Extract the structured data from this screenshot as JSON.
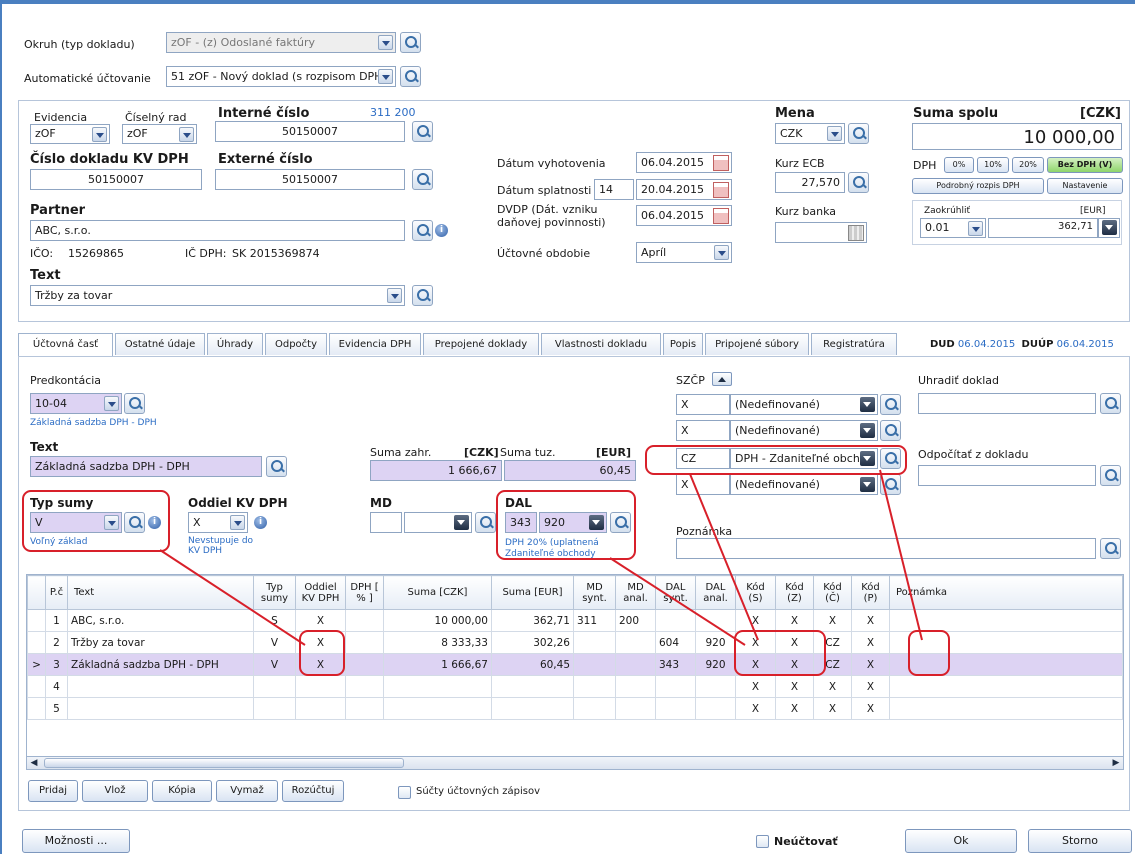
{
  "top": {
    "okruh_label": "Okruh (typ dokladu)",
    "okruh_value": "zOF - (z) Odoslané faktúry",
    "auto_label": "Automatické účtovanie",
    "auto_value": "51 zOF - Nový doklad (s rozpisom DPH"
  },
  "header": {
    "evidencia_label": "Evidencia",
    "evidencia_value": "zOF",
    "ciselny_rad_label": "Číselný rad",
    "ciselny_rad_value": "zOF",
    "interne_label": "Interné číslo",
    "interne_counter": "311 200",
    "interne_value": "50150007",
    "kvdph_label": "Číslo dokladu KV DPH",
    "kvdph_value": "50150007",
    "externe_label": "Externé číslo",
    "externe_value": "50150007",
    "partner_label": "Partner",
    "partner_value": "ABC, s.r.o.",
    "ico_label": "IČO:",
    "ico_value": "15269865",
    "icdph_label": "IČ DPH:",
    "icdph_value": "SK 2015369874",
    "text_label": "Text",
    "text_value": "Tržby za tovar"
  },
  "dates": {
    "vyhotovenia_label": "Dátum vyhotovenia",
    "vyhotovenia_value": "06.04.2015",
    "splatnosti_label": "Dátum splatnosti",
    "splatnosti_days": "14",
    "splatnosti_value": "20.04.2015",
    "dvdp_label": "DVDP (Dát. vzniku daňovej povinnosti)",
    "dvdp_value": "06.04.2015",
    "obdobie_label": "Účtovné obdobie",
    "obdobie_value": "Apríl"
  },
  "currency": {
    "mena_label": "Mena",
    "mena_value": "CZK",
    "kurz_ecb_label": "Kurz ECB",
    "kurz_ecb_value": "27,570",
    "kurz_banka_label": "Kurz banka",
    "kurz_banka_value": ""
  },
  "suma": {
    "label": "Suma spolu",
    "unit": "[CZK]",
    "value": "10 000,00",
    "dph_label": "DPH",
    "dph_buttons": [
      "0%",
      "10%",
      "20%",
      "Bez DPH (V)"
    ],
    "rozpis_button": "Podrobný rozpis DPH",
    "nastavenie_button": "Nastavenie",
    "zaokruhlit_label": "Zaokrúhliť",
    "eur_label": "[EUR]",
    "zaokruhlit_value": "0.01",
    "eur_value": "362,71"
  },
  "tabs": [
    "Účtovná časť",
    "Ostatné údaje",
    "Úhrady",
    "Odpočty",
    "Evidencia DPH",
    "Prepojené doklady",
    "Vlastnosti dokladu",
    "Popis",
    "Pripojené súbory",
    "Registratúra"
  ],
  "dud": {
    "dud_label": "DUD",
    "dud_value": "06.04.2015",
    "duup_label": "DUÚP",
    "duup_value": "06.04.2015"
  },
  "entry": {
    "predkontacia_label": "Predkontácia",
    "predkontacia_value": "10-04",
    "predkontacia_desc": "Základná sadzba DPH - DPH",
    "text_label": "Text",
    "text_value": "Základná sadzba DPH - DPH",
    "suma_zahr_label": "Suma zahr.",
    "czk_label": "[CZK]",
    "suma_tuz_label": "Suma tuz.",
    "eur_label": "[EUR]",
    "suma_zahr_value": "1 666,67",
    "suma_tuz_value": "60,45",
    "typ_sumy_label": "Typ sumy",
    "typ_sumy_value": "V",
    "typ_sumy_desc": "Voľný základ",
    "oddiel_label": "Oddiel KV DPH",
    "oddiel_value": "X",
    "oddiel_desc": "Nevstupuje do KV DPH",
    "md_label": "MD",
    "dal_label": "DAL",
    "dal_synt": "343",
    "dal_anal": "920",
    "dal_desc": "DPH 20% (uplatnená Zdaniteľné obchody",
    "szcp_label": "SZČP",
    "szcp_rows": [
      {
        "code": "X",
        "desc": "(Nedefinované)"
      },
      {
        "code": "X",
        "desc": "(Nedefinované)"
      },
      {
        "code": "CZ",
        "desc": "DPH - Zdaniteľné obch"
      },
      {
        "code": "X",
        "desc": "(Nedefinované)"
      }
    ],
    "uhradit_label": "Uhradiť doklad",
    "odpocitat_label": "Odpočítať z dokladu",
    "poznamka_label": "Poznámka"
  },
  "grid": {
    "headers": [
      "P.č",
      "Text",
      "Typ sumy",
      "Oddiel KV DPH",
      "DPH [ % ]",
      "Suma [CZK]",
      "Suma [EUR]",
      "MD synt.",
      "MD anal.",
      "DAL synt.",
      "DAL anal.",
      "Kód (S)",
      "Kód (Z)",
      "Kód (Č)",
      "Kód (P)",
      "Poznámka"
    ],
    "rows": [
      [
        "1",
        "ABC, s.r.o.",
        "S",
        "X",
        "",
        "10 000,00",
        "362,71",
        "311",
        "200",
        "",
        "",
        "X",
        "X",
        "X",
        "X",
        ""
      ],
      [
        "2",
        "Tržby za tovar",
        "V",
        "X",
        "",
        "8 333,33",
        "302,26",
        "",
        "",
        "604",
        "920",
        "X",
        "X",
        "CZ",
        "X",
        ""
      ],
      [
        "3",
        "Základná sadzba DPH - DPH",
        "V",
        "X",
        "",
        "1 666,67",
        "60,45",
        "",
        "",
        "343",
        "920",
        "X",
        "X",
        "CZ",
        "X",
        ""
      ],
      [
        "4",
        "",
        "",
        "",
        "",
        "",
        "",
        "",
        "",
        "",
        "",
        "X",
        "X",
        "X",
        "X",
        ""
      ],
      [
        "5",
        "",
        "",
        "",
        "",
        "",
        "",
        "",
        "",
        "",
        "",
        "X",
        "X",
        "X",
        "X",
        ""
      ]
    ]
  },
  "grid_buttons": [
    "Pridaj",
    "Vlož",
    "Kópia",
    "Vymaž",
    "Rozúčtuj"
  ],
  "sucty_label": "Súčty účtovných zápisov",
  "footer": {
    "moznosti": "Možnosti ...",
    "neuctovat": "Neúčtovať",
    "ok": "Ok",
    "storno": "Storno"
  },
  "colors": {
    "accent": "#2b6cc4",
    "highlight": "#d8202a",
    "selected_row": "#ddd3f3"
  }
}
